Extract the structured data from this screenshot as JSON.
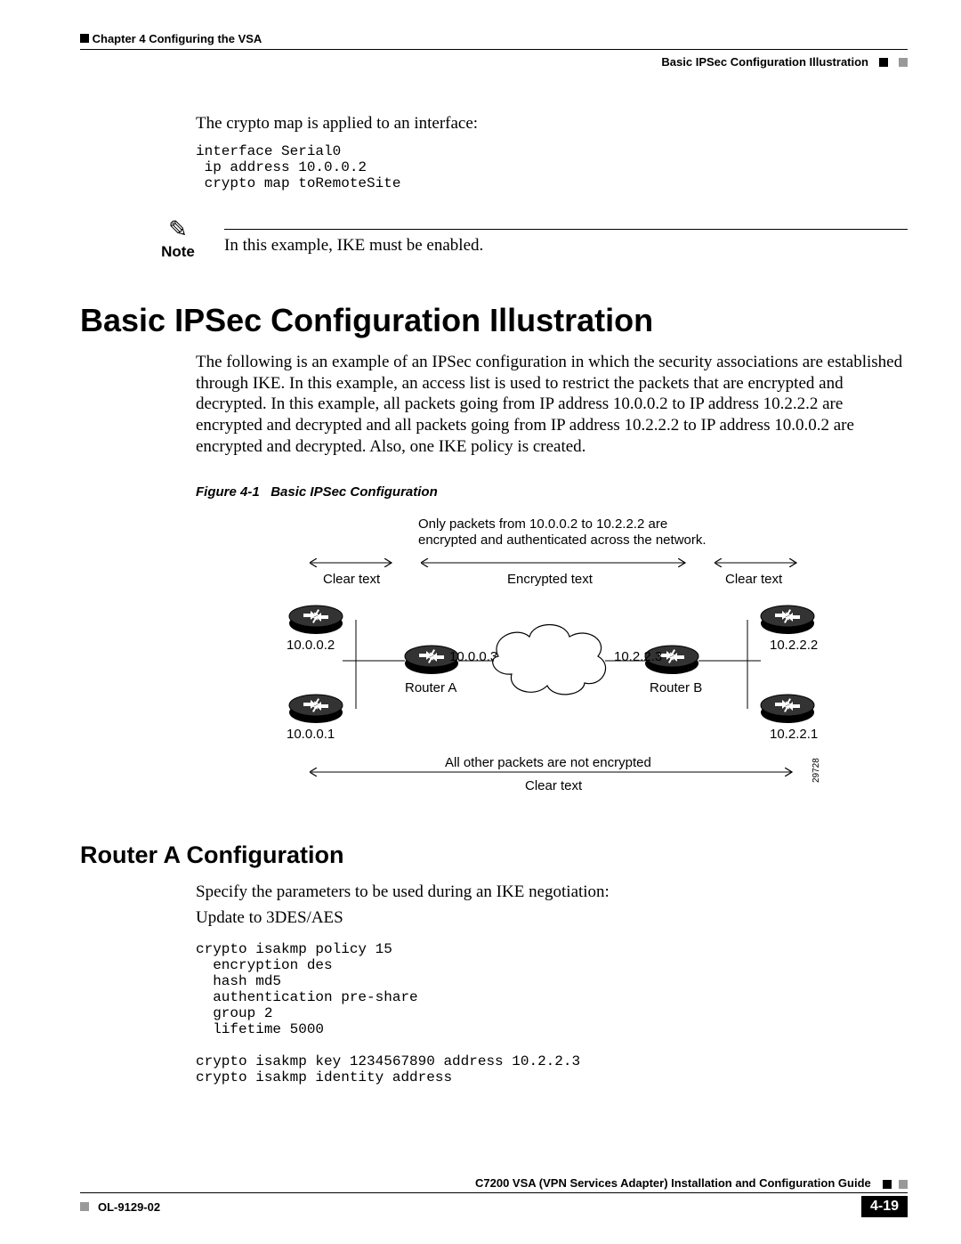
{
  "header": {
    "chapter": "Chapter 4    Configuring the VSA",
    "section": "Basic IPSec Configuration Illustration"
  },
  "intro": {
    "line1": "The crypto map is applied to an interface:",
    "code": "interface Serial0\n ip address 10.0.0.2\n crypto map toRemoteSite"
  },
  "note": {
    "label": "Note",
    "text": "In this example, IKE must be enabled."
  },
  "h1": "Basic IPSec Configuration Illustration",
  "para1": "The following is an example of an IPSec configuration in which the security associations are established through IKE. In this example, an access list is used to restrict the packets that are encrypted and decrypted. In this example, all packets going from IP address 10.0.0.2 to IP address 10.2.2.2 are encrypted and decrypted and all packets going from IP address 10.2.2.2 to IP address 10.0.0.2 are encrypted and decrypted. Also, one IKE policy is created.",
  "figcap_num": "Figure 4-1",
  "figcap_title": "Basic IPSec Configuration",
  "diagram": {
    "top_desc1": "Only packets from 10.0.0.2 to 10.2.2.2 are",
    "top_desc2": "encrypted and authenticated across the network.",
    "clear_text": "Clear text",
    "encrypted_text": "Encrypted text",
    "ip_tl": "10.0.0.2",
    "ip_bl": "10.0.0.1",
    "ip_tr": "10.2.2.2",
    "ip_br": "10.2.2.1",
    "ip_ra": "10.0.0.3",
    "ip_rb": "10.2.2.3",
    "router_a": "Router A",
    "router_b": "Router B",
    "bottom1": "All other packets are not encrypted",
    "bottom2": "Clear text",
    "figid": "29728"
  },
  "h2": "Router A Configuration",
  "para2a": "Specify the parameters to be used during an IKE negotiation:",
  "para2b": "Update to 3DES/AES",
  "code2": "crypto isakmp policy 15\n  encryption des\n  hash md5\n  authentication pre-share\n  group 2\n  lifetime 5000\n\ncrypto isakmp key 1234567890 address 10.2.2.3\ncrypto isakmp identity address",
  "footer": {
    "guide": "C7200 VSA (VPN Services Adapter) Installation and Configuration Guide",
    "doc": "OL-9129-02",
    "page": "4-19"
  }
}
